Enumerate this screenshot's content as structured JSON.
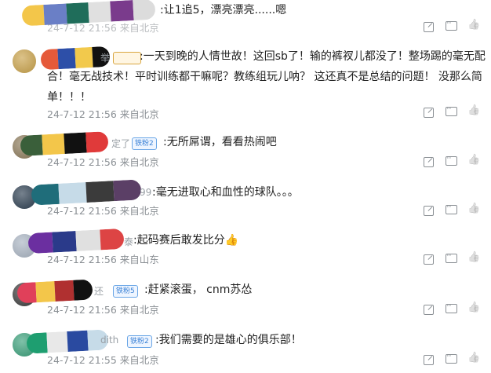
{
  "comments": [
    {
      "text": ":让1追5，漂亮漂亮......嗯",
      "meta": "24-7-12 21:56 来自北京"
    },
    {
      "text_lines": [
        ":一天到晚的人情世故！这回sb了！输的裤衩儿都没了！整场踢的毫无配",
        "合！毫无战技术！平时训练都干嘛呢？教练组玩儿呐？ 这还真不是总结的问题！ 没那么简",
        "单！！！"
      ],
      "meta": "24-7-12 21:56 来自北京",
      "name_tail": "举",
      "badge": ""
    },
    {
      "text": ":无所屌谓，看看热闹吧",
      "meta": "24-7-12 21:56 来自北京",
      "name_tail": "定了",
      "badge": "铁粉2"
    },
    {
      "text": ":毫无进取心和血性的球队。。。",
      "meta": "24-7-12 21:56 来自北京",
      "name_tail": "99"
    },
    {
      "text": ":起码赛后敢发比分👍",
      "meta": "24-7-12 21:56 来自山东",
      "name_tail": "泰"
    },
    {
      "text": ":赶紧滚蛋， cnm苏怂",
      "meta": "24-7-12 21:56 来自北京",
      "name_tail": "还",
      "badge": "铁粉5"
    },
    {
      "text": ":我们需要的是雄心的俱乐部！",
      "meta": "24-7-12 21:55 来自北京",
      "name_tail": "dith",
      "badge": "铁粉2"
    }
  ],
  "actions": [
    "share-icon",
    "reply-icon",
    "like-icon"
  ],
  "colors": {
    "meta": "#8a8f94",
    "text": "#222222",
    "badge_blue": "#3b82d6"
  }
}
